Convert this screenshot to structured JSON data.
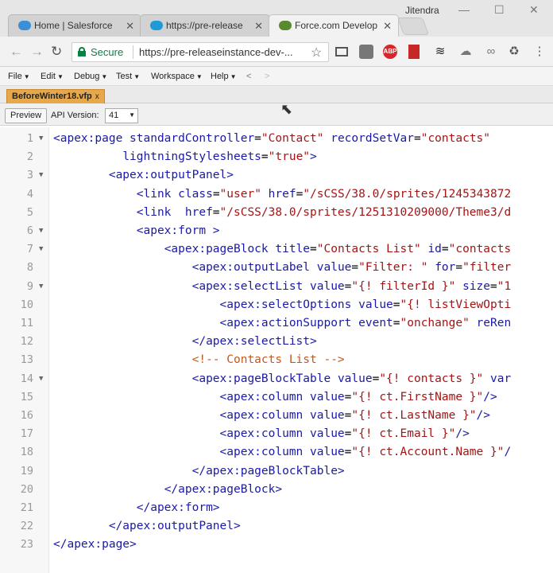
{
  "browser": {
    "user_name": "Jitendra",
    "tabs": [
      {
        "label": "Home | Salesforce",
        "active": false,
        "favicon": "salesforce-cloud-icon"
      },
      {
        "label": "https://pre-release",
        "active": false,
        "favicon": "salesforce-cloud-icon"
      },
      {
        "label": "Force.com Develope",
        "active": true,
        "favicon": "force-cloud-icon"
      }
    ],
    "security_label": "Secure",
    "url": "https://pre-releaseinstance-dev-...",
    "extensions": [
      "cast-icon",
      "screenshot-icon",
      "abp-icon",
      "bookmark-red-icon",
      "layers-icon",
      "cloud-icon",
      "infinity-icon",
      "recycle-icon",
      "more-icon"
    ],
    "abp_text": "ABP"
  },
  "dev_console": {
    "menus": [
      "File",
      "Edit",
      "Debug",
      "Test",
      "Workspace",
      "Help"
    ],
    "nav_back": "<",
    "nav_forward": ">",
    "file_tab": "BeforeWinter18.vfp",
    "file_tab_close": "x",
    "preview_label": "Preview",
    "api_label": "API Version:",
    "api_version": "41"
  },
  "editor": {
    "lines": [
      {
        "n": "1",
        "fold": true,
        "tokens": [
          [
            "tag",
            "<apex:page "
          ],
          [
            "attr",
            "standardController"
          ],
          [
            "plain",
            "="
          ],
          [
            "str",
            "\"Contact\""
          ],
          [
            "plain",
            " "
          ],
          [
            "attr",
            "recordSetVar"
          ],
          [
            "plain",
            "="
          ],
          [
            "str",
            "\"contacts\""
          ]
        ]
      },
      {
        "n": "2",
        "fold": false,
        "tokens": [
          [
            "plain",
            "          "
          ],
          [
            "attr",
            "lightningStylesheets"
          ],
          [
            "plain",
            "="
          ],
          [
            "str",
            "\"true\""
          ],
          [
            "tag",
            ">"
          ]
        ]
      },
      {
        "n": "3",
        "fold": true,
        "tokens": [
          [
            "plain",
            "        "
          ],
          [
            "tag",
            "<apex:outputPanel>"
          ]
        ]
      },
      {
        "n": "4",
        "fold": false,
        "tokens": [
          [
            "plain",
            "            "
          ],
          [
            "tag",
            "<link "
          ],
          [
            "attr",
            "class"
          ],
          [
            "plain",
            "="
          ],
          [
            "str",
            "\"user\""
          ],
          [
            "plain",
            " "
          ],
          [
            "attr",
            "href"
          ],
          [
            "plain",
            "="
          ],
          [
            "str",
            "\"/sCSS/38.0/sprites/1245343872"
          ]
        ]
      },
      {
        "n": "5",
        "fold": false,
        "tokens": [
          [
            "plain",
            "            "
          ],
          [
            "tag",
            "<link  "
          ],
          [
            "attr",
            "href"
          ],
          [
            "plain",
            "="
          ],
          [
            "str",
            "\"/sCSS/38.0/sprites/1251310209000/Theme3/d"
          ]
        ]
      },
      {
        "n": "6",
        "fold": true,
        "tokens": [
          [
            "plain",
            "            "
          ],
          [
            "tag",
            "<apex:form >"
          ]
        ]
      },
      {
        "n": "7",
        "fold": true,
        "tokens": [
          [
            "plain",
            "                "
          ],
          [
            "tag",
            "<apex:pageBlock "
          ],
          [
            "attr",
            "title"
          ],
          [
            "plain",
            "="
          ],
          [
            "str",
            "\"Contacts List\""
          ],
          [
            "plain",
            " "
          ],
          [
            "attr",
            "id"
          ],
          [
            "plain",
            "="
          ],
          [
            "str",
            "\"contacts"
          ]
        ]
      },
      {
        "n": "8",
        "fold": false,
        "tokens": [
          [
            "plain",
            "                    "
          ],
          [
            "tag",
            "<apex:outputLabel "
          ],
          [
            "attr",
            "value"
          ],
          [
            "plain",
            "="
          ],
          [
            "str",
            "\"Filter: \""
          ],
          [
            "plain",
            " "
          ],
          [
            "attr",
            "for"
          ],
          [
            "plain",
            "="
          ],
          [
            "str",
            "\"filter"
          ]
        ]
      },
      {
        "n": "9",
        "fold": true,
        "tokens": [
          [
            "plain",
            "                    "
          ],
          [
            "tag",
            "<apex:selectList "
          ],
          [
            "attr",
            "value"
          ],
          [
            "plain",
            "="
          ],
          [
            "str",
            "\"{! filterId }\""
          ],
          [
            "plain",
            " "
          ],
          [
            "attr",
            "size"
          ],
          [
            "plain",
            "="
          ],
          [
            "str",
            "\"1"
          ]
        ]
      },
      {
        "n": "10",
        "fold": false,
        "tokens": [
          [
            "plain",
            "                        "
          ],
          [
            "tag",
            "<apex:selectOptions "
          ],
          [
            "attr",
            "value"
          ],
          [
            "plain",
            "="
          ],
          [
            "str",
            "\"{! listViewOpti"
          ]
        ]
      },
      {
        "n": "11",
        "fold": false,
        "tokens": [
          [
            "plain",
            "                        "
          ],
          [
            "tag",
            "<apex:actionSupport "
          ],
          [
            "attr",
            "event"
          ],
          [
            "plain",
            "="
          ],
          [
            "str",
            "\"onchange\""
          ],
          [
            "plain",
            " "
          ],
          [
            "attr",
            "reRen"
          ]
        ]
      },
      {
        "n": "12",
        "fold": false,
        "tokens": [
          [
            "plain",
            "                    "
          ],
          [
            "tag",
            "</apex:selectList>"
          ]
        ]
      },
      {
        "n": "13",
        "fold": false,
        "tokens": [
          [
            "plain",
            "                    "
          ],
          [
            "cmt",
            "<!-- Contacts List -->"
          ]
        ]
      },
      {
        "n": "14",
        "fold": true,
        "tokens": [
          [
            "plain",
            "                    "
          ],
          [
            "tag",
            "<apex:pageBlockTable "
          ],
          [
            "attr",
            "value"
          ],
          [
            "plain",
            "="
          ],
          [
            "str",
            "\"{! contacts }\""
          ],
          [
            "plain",
            " "
          ],
          [
            "attr",
            "var"
          ]
        ]
      },
      {
        "n": "15",
        "fold": false,
        "tokens": [
          [
            "plain",
            "                        "
          ],
          [
            "tag",
            "<apex:column "
          ],
          [
            "attr",
            "value"
          ],
          [
            "plain",
            "="
          ],
          [
            "str",
            "\"{! ct.FirstName }\""
          ],
          [
            "tag",
            "/>"
          ]
        ]
      },
      {
        "n": "16",
        "fold": false,
        "tokens": [
          [
            "plain",
            "                        "
          ],
          [
            "tag",
            "<apex:column "
          ],
          [
            "attr",
            "value"
          ],
          [
            "plain",
            "="
          ],
          [
            "str",
            "\"{! ct.LastName }\""
          ],
          [
            "tag",
            "/>"
          ]
        ]
      },
      {
        "n": "17",
        "fold": false,
        "tokens": [
          [
            "plain",
            "                        "
          ],
          [
            "tag",
            "<apex:column "
          ],
          [
            "attr",
            "value"
          ],
          [
            "plain",
            "="
          ],
          [
            "str",
            "\"{! ct.Email }\""
          ],
          [
            "tag",
            "/>"
          ]
        ]
      },
      {
        "n": "18",
        "fold": false,
        "tokens": [
          [
            "plain",
            "                        "
          ],
          [
            "tag",
            "<apex:column "
          ],
          [
            "attr",
            "value"
          ],
          [
            "plain",
            "="
          ],
          [
            "str",
            "\"{! ct.Account.Name }\""
          ],
          [
            "tag",
            "/"
          ]
        ]
      },
      {
        "n": "19",
        "fold": false,
        "tokens": [
          [
            "plain",
            "                    "
          ],
          [
            "tag",
            "</apex:pageBlockTable>"
          ]
        ]
      },
      {
        "n": "20",
        "fold": false,
        "tokens": [
          [
            "plain",
            "                "
          ],
          [
            "tag",
            "</apex:pageBlock>"
          ]
        ]
      },
      {
        "n": "21",
        "fold": false,
        "tokens": [
          [
            "plain",
            "            "
          ],
          [
            "tag",
            "</apex:form>"
          ]
        ]
      },
      {
        "n": "22",
        "fold": false,
        "tokens": [
          [
            "plain",
            "        "
          ],
          [
            "tag",
            "</apex:outputPanel>"
          ]
        ]
      },
      {
        "n": "23",
        "fold": false,
        "tokens": [
          [
            "tag",
            "</apex:page>"
          ]
        ]
      }
    ]
  }
}
